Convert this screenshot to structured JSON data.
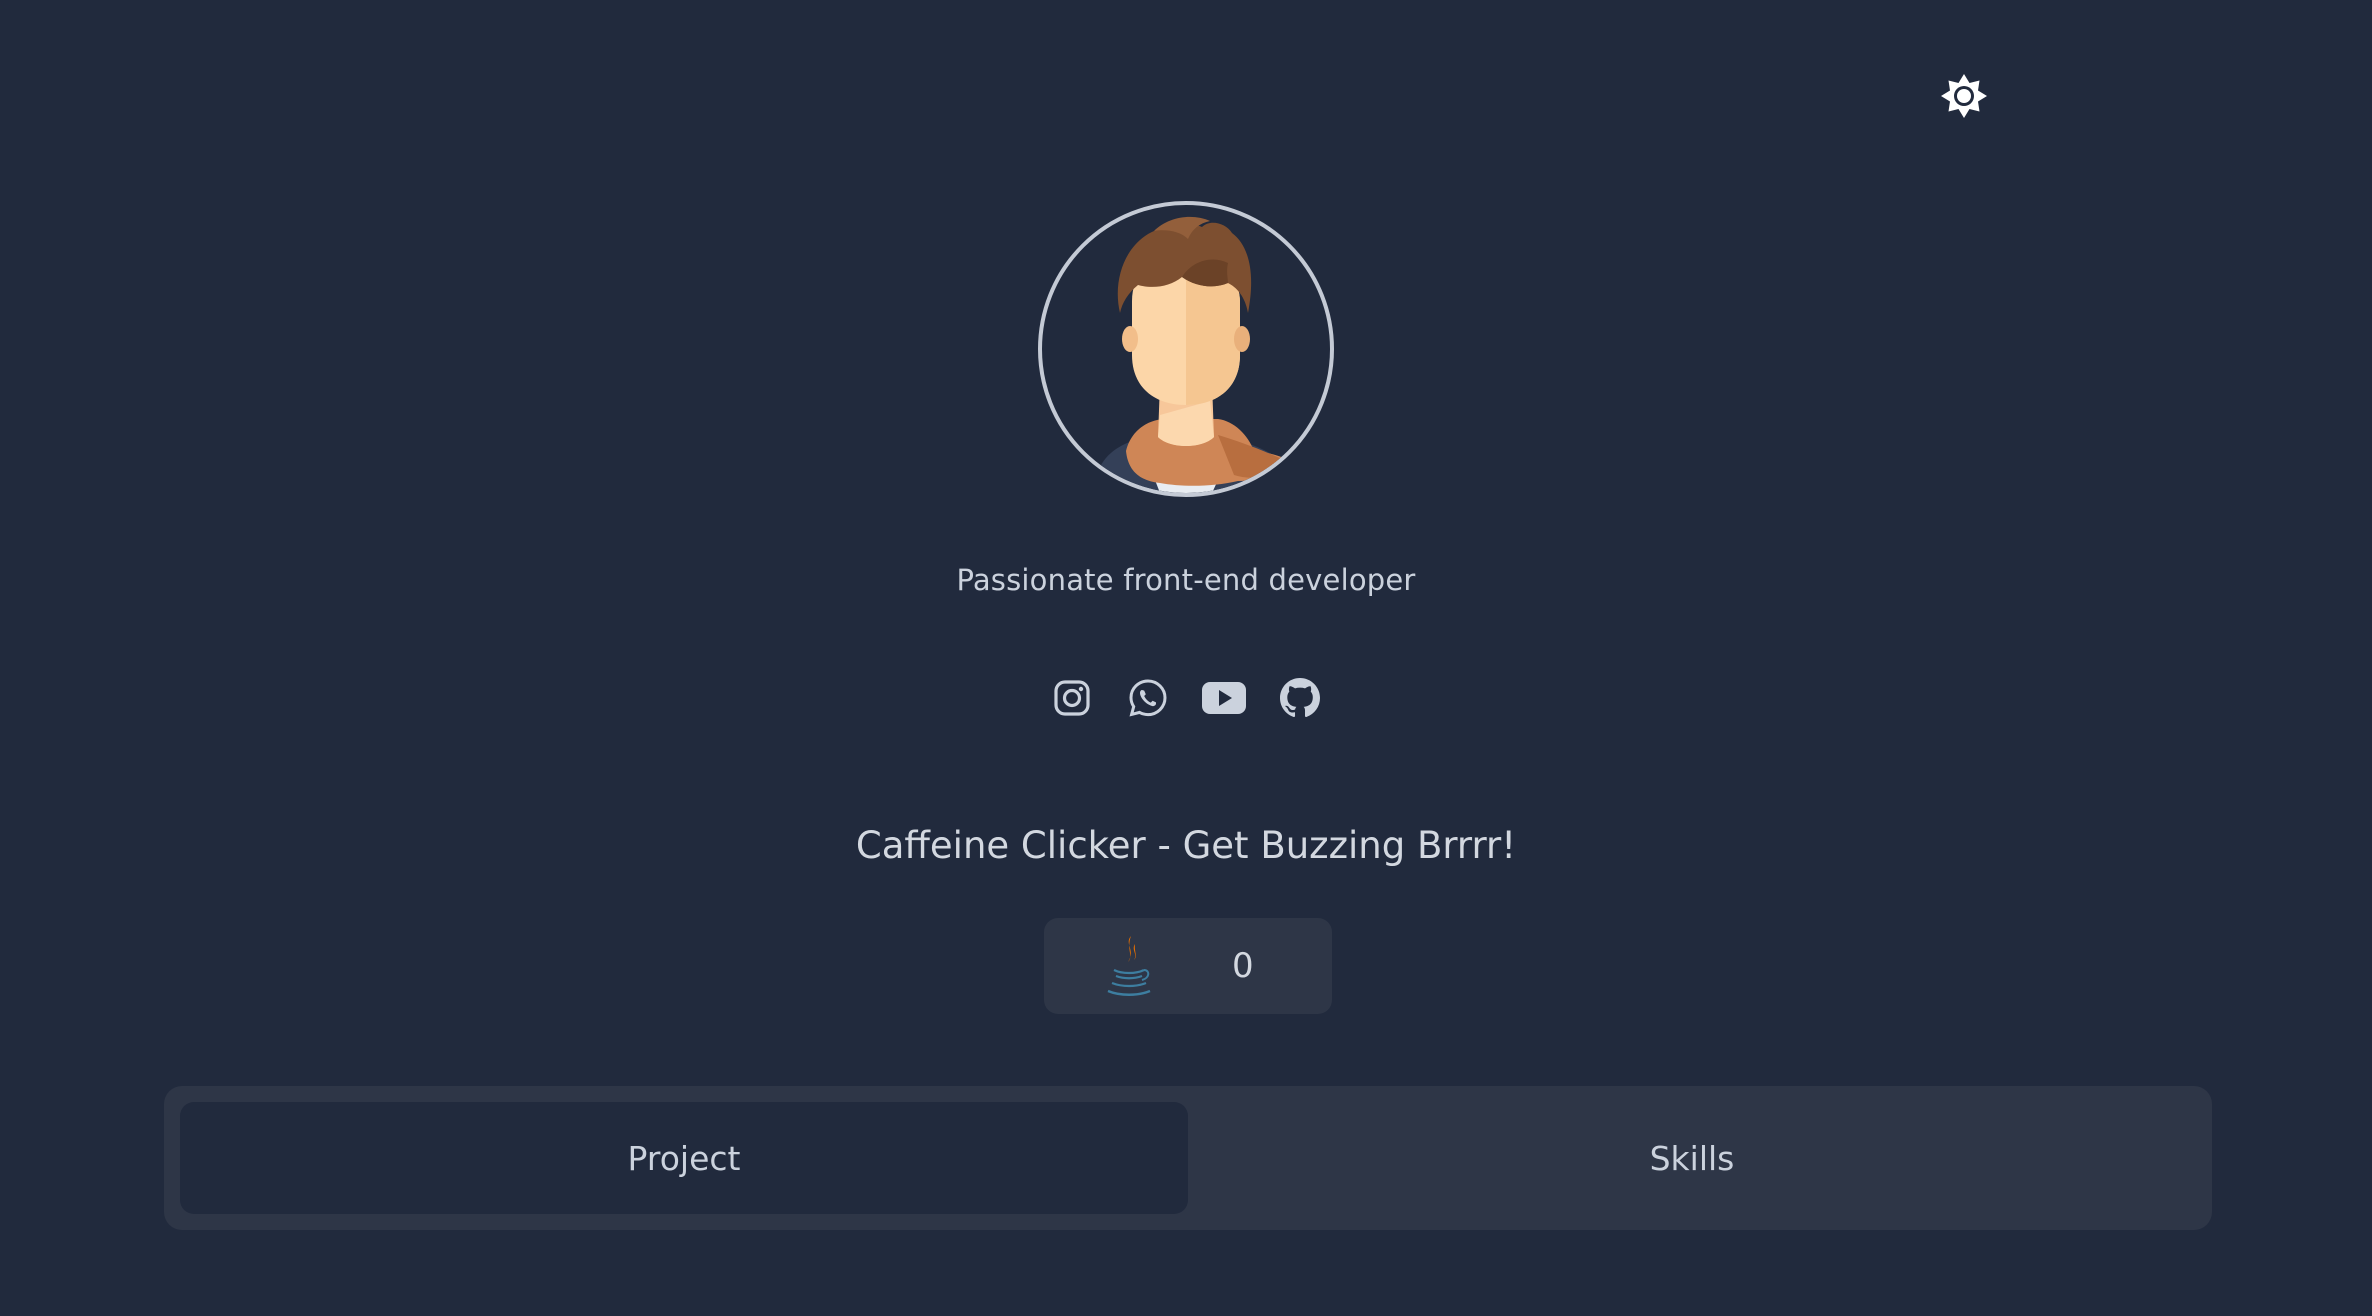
{
  "header": {
    "theme_toggle_icon": "sun-icon"
  },
  "profile": {
    "avatar_icon": "avatar-illustration",
    "tagline": "Passionate front-end developer"
  },
  "socials": [
    {
      "name": "instagram",
      "icon": "instagram-icon"
    },
    {
      "name": "whatsapp",
      "icon": "whatsapp-icon"
    },
    {
      "name": "youtube",
      "icon": "youtube-icon"
    },
    {
      "name": "github",
      "icon": "github-icon"
    }
  ],
  "game": {
    "title": "Caffeine Clicker - Get Buzzing Brrrr!",
    "icon": "coffee-cup-icon",
    "count": "0"
  },
  "tabs": [
    {
      "label": "Project",
      "active": true
    },
    {
      "label": "Skills",
      "active": false
    }
  ],
  "colors": {
    "background": "#212a3d",
    "panel": "#2e3647",
    "text": "#cbd2dd"
  }
}
